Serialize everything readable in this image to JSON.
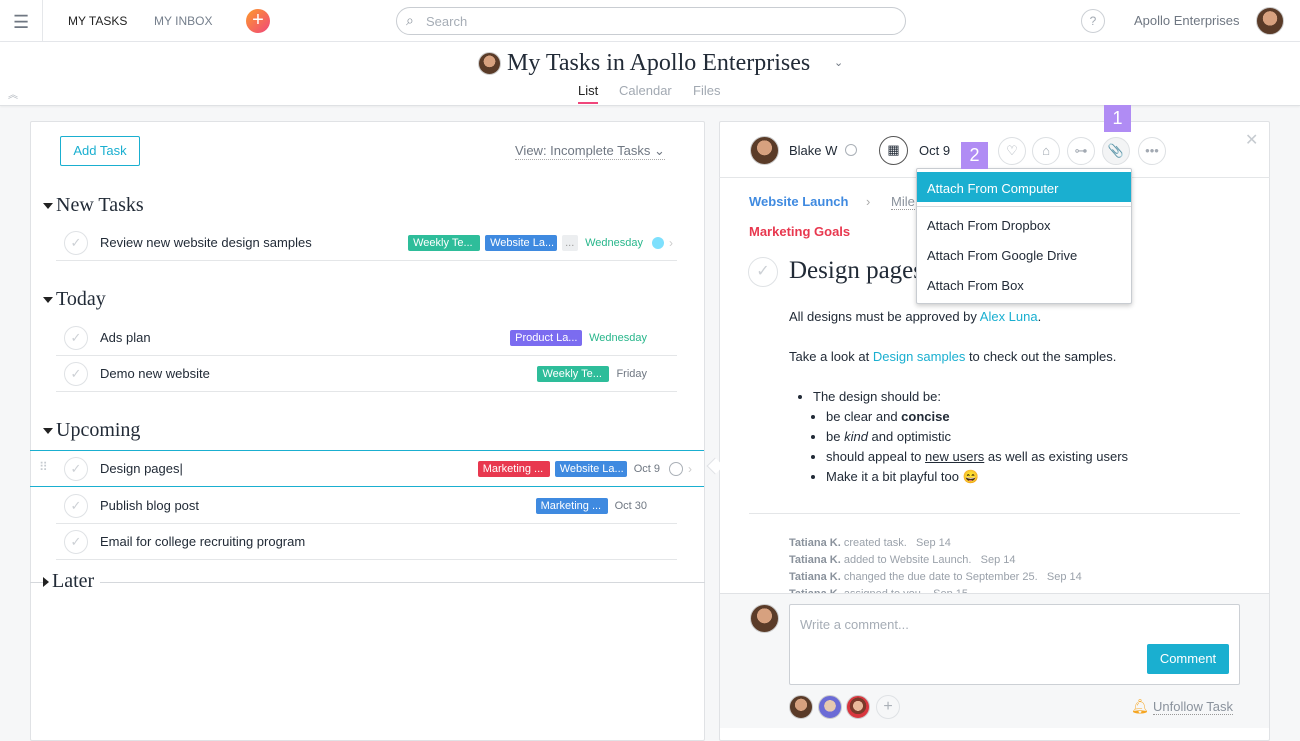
{
  "topbar": {
    "my_tasks": "MY TASKS",
    "my_inbox": "MY INBOX",
    "search_placeholder": "Search",
    "help": "?",
    "org": "Apollo Enterprises"
  },
  "header": {
    "title": "My Tasks in Apollo Enterprises",
    "tabs": [
      "List",
      "Calendar",
      "Files"
    ],
    "active_tab": "List"
  },
  "list": {
    "add_task": "Add Task",
    "view": "View: Incomplete Tasks",
    "sections": [
      {
        "name": "New Tasks",
        "tasks": [
          {
            "name": "Review new website design samples",
            "tags": [
              {
                "label": "Weekly Te...",
                "color": "#2ebd9a"
              },
              {
                "label": "Website La...",
                "color": "#3f8ae0"
              },
              {
                "label": "...",
                "color": "#eceef0"
              }
            ],
            "due": "Wednesday",
            "due_color": "#28b68b"
          }
        ]
      },
      {
        "name": "Today",
        "tasks": [
          {
            "name": "Ads plan",
            "tags": [
              {
                "label": "Product La...",
                "color": "#7b6cf0"
              }
            ],
            "due": "Wednesday",
            "due_color": "#28b68b"
          },
          {
            "name": "Demo new website",
            "tags": [
              {
                "label": "Weekly Te...",
                "color": "#2ebd9a"
              }
            ],
            "due": "Friday"
          }
        ]
      },
      {
        "name": "Upcoming",
        "tasks": [
          {
            "name": "Design pages",
            "tags": [
              {
                "label": "Marketing ...",
                "color": "#e8384f"
              },
              {
                "label": "Website La...",
                "color": "#3f8ae0"
              }
            ],
            "due": "Oct 9",
            "selected": true
          },
          {
            "name": "Publish blog post",
            "tags": [
              {
                "label": "Marketing ...",
                "color": "#3f8ae0"
              }
            ],
            "due": "Oct 30"
          },
          {
            "name": "Email for college recruiting program",
            "tags": [],
            "due": ""
          }
        ]
      },
      {
        "name": "Later",
        "tasks": []
      }
    ]
  },
  "detail": {
    "assignee": "Blake W",
    "due": "Oct 9",
    "breadcrumb_project": "Website Launch",
    "breadcrumb_section": "Mile",
    "project2": "Marketing Goals",
    "title": "Design pages",
    "desc1_pre": "All designs must be approved by ",
    "desc1_link": "Alex Luna",
    "desc1_post": ".",
    "desc2_pre": "Take a look at ",
    "desc2_link": "Design samples",
    "desc2_post": " to check out the samples.",
    "bullet": "The design should be:",
    "sub": {
      "b1_pre": "be clear and ",
      "b1_bold": "concise",
      "b2_pre": "be ",
      "b2_it": "kind",
      "b2_post": " and optimistic",
      "b3_pre": "should appeal to ",
      "b3_u": "new users",
      "b3_post": " as well as existing users",
      "b4": "Make it a bit playful too 😄"
    },
    "activity": [
      {
        "who": "Tatiana K.",
        "what": "created task.",
        "when": "Sep 14"
      },
      {
        "who": "Tatiana K.",
        "what": "added to Website Launch.",
        "when": "Sep 14"
      },
      {
        "who": "Tatiana K.",
        "what": "changed the due date to September 25.",
        "when": "Sep 14"
      },
      {
        "who": "Tatiana K.",
        "what": "assigned to you.",
        "when": "Sep 15"
      }
    ],
    "comment_placeholder": "Write a comment...",
    "comment_button": "Comment",
    "unfollow": "Unfollow Task"
  },
  "attach_menu": {
    "items": [
      "Attach From Computer",
      "Attach From Dropbox",
      "Attach From Google Drive",
      "Attach From Box"
    ],
    "highlighted": "Attach From Computer"
  },
  "annotations": [
    "1",
    "2"
  ],
  "colors": {
    "accent": "#1aafd0",
    "badge": "#b08cf4"
  }
}
